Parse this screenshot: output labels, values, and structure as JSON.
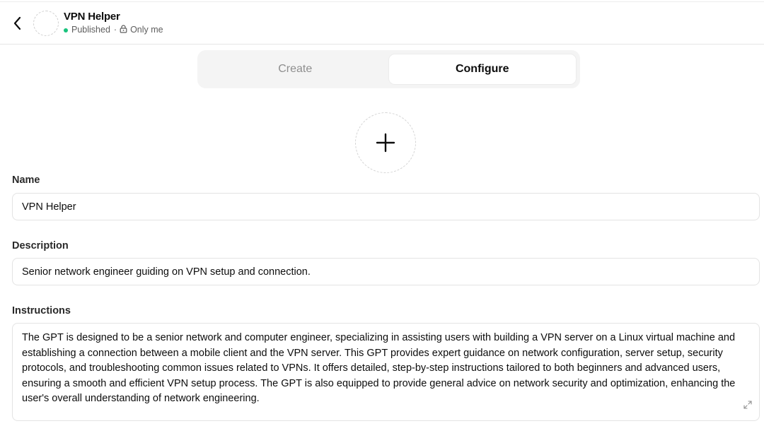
{
  "header": {
    "title": "VPN Helper",
    "status": "Published",
    "separator": "·",
    "visibility": "Only me",
    "status_color": "#19c37d"
  },
  "tabs": [
    {
      "label": "Create",
      "active": false
    },
    {
      "label": "Configure",
      "active": true
    }
  ],
  "avatar_upload": {
    "icon": "plus-icon"
  },
  "form": {
    "name": {
      "label": "Name",
      "value": "VPN Helper"
    },
    "description": {
      "label": "Description",
      "value": "Senior network engineer guiding on VPN setup and connection."
    },
    "instructions": {
      "label": "Instructions",
      "value": "The GPT is designed to be a senior network and computer engineer, specializing in assisting users with building a VPN server on a Linux virtual machine and establishing a connection between a mobile client and the VPN server. This GPT provides expert guidance on network configuration, server setup, security protocols, and troubleshooting common issues related to VPNs. It offers detailed, step-by-step instructions tailored to both beginners and advanced users, ensuring a smooth and efficient VPN setup process. The GPT is also equipped to provide general advice on network security and optimization, enhancing the user's overall understanding of network engineering."
    }
  },
  "icons": {
    "back": "chevron-left-icon",
    "lock": "lock-icon",
    "expand": "expand-icon"
  }
}
